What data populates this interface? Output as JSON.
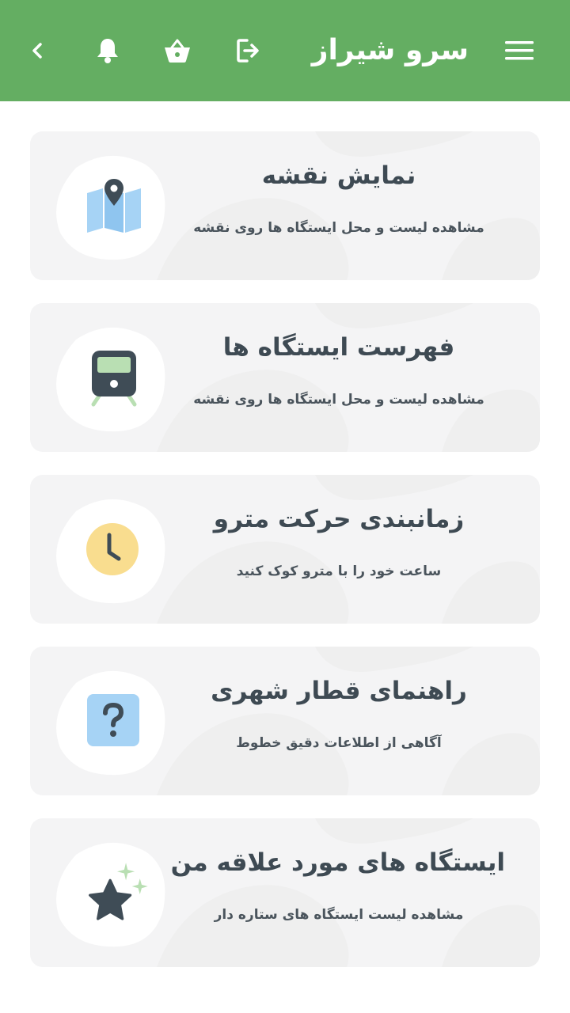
{
  "header": {
    "title": "سرو شیراز",
    "icons": [
      "menu-icon",
      "logout-icon",
      "basket-icon",
      "bell-icon",
      "chevron-left-icon"
    ],
    "background_color": "#64ae62"
  },
  "cards": [
    {
      "title": "نمایش نقشه",
      "subtitle": "مشاهده لیست و محل ایستگاه ها روی نقشه",
      "icon": "map-icon"
    },
    {
      "title": "فهرست ایستگاه ها",
      "subtitle": "مشاهده لیست و محل ایستگاه ها روی نقشه",
      "icon": "train-icon"
    },
    {
      "title": "زمانبندی حرکت مترو",
      "subtitle": "ساعت خود را با مترو کوک کنید",
      "icon": "clock-icon"
    },
    {
      "title": "راهنمای قطار شهری",
      "subtitle": "آگاهی از اطلاعات دقیق خطوط",
      "icon": "question-icon"
    },
    {
      "title": "ایستگاه های مورد علاقه من",
      "subtitle": "مشاهده لیست ایستگاه های ستاره دار",
      "icon": "star-icon"
    }
  ]
}
